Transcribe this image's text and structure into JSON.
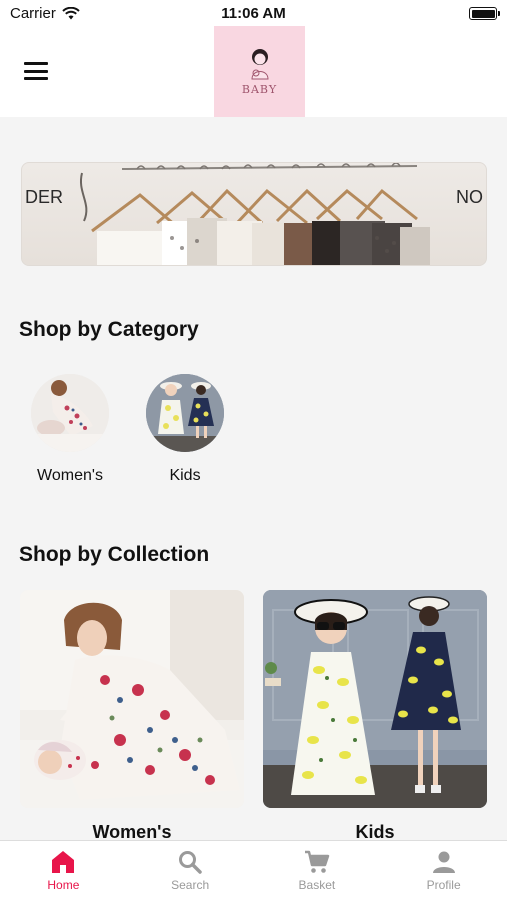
{
  "status_bar": {
    "carrier": "Carrier",
    "time": "11:06 AM"
  },
  "header": {
    "logo_text": "BABY"
  },
  "banner": {
    "left_text": "DER",
    "right_text": "NO"
  },
  "categories": {
    "title": "Shop by Category",
    "items": [
      {
        "label": "Women's"
      },
      {
        "label": "Kids"
      }
    ]
  },
  "collections": {
    "title": "Shop by Collection",
    "items": [
      {
        "label": "Women's"
      },
      {
        "label": "Kids"
      }
    ]
  },
  "tab_bar": {
    "items": [
      {
        "label": "Home",
        "icon": "home-icon",
        "active": true
      },
      {
        "label": "Search",
        "icon": "search-icon",
        "active": false
      },
      {
        "label": "Basket",
        "icon": "cart-icon",
        "active": false
      },
      {
        "label": "Profile",
        "icon": "profile-icon",
        "active": false
      }
    ]
  },
  "colors": {
    "accent": "#e8154a",
    "inactive": "#9a9a9a",
    "logo_bg": "#f9d7e1"
  }
}
